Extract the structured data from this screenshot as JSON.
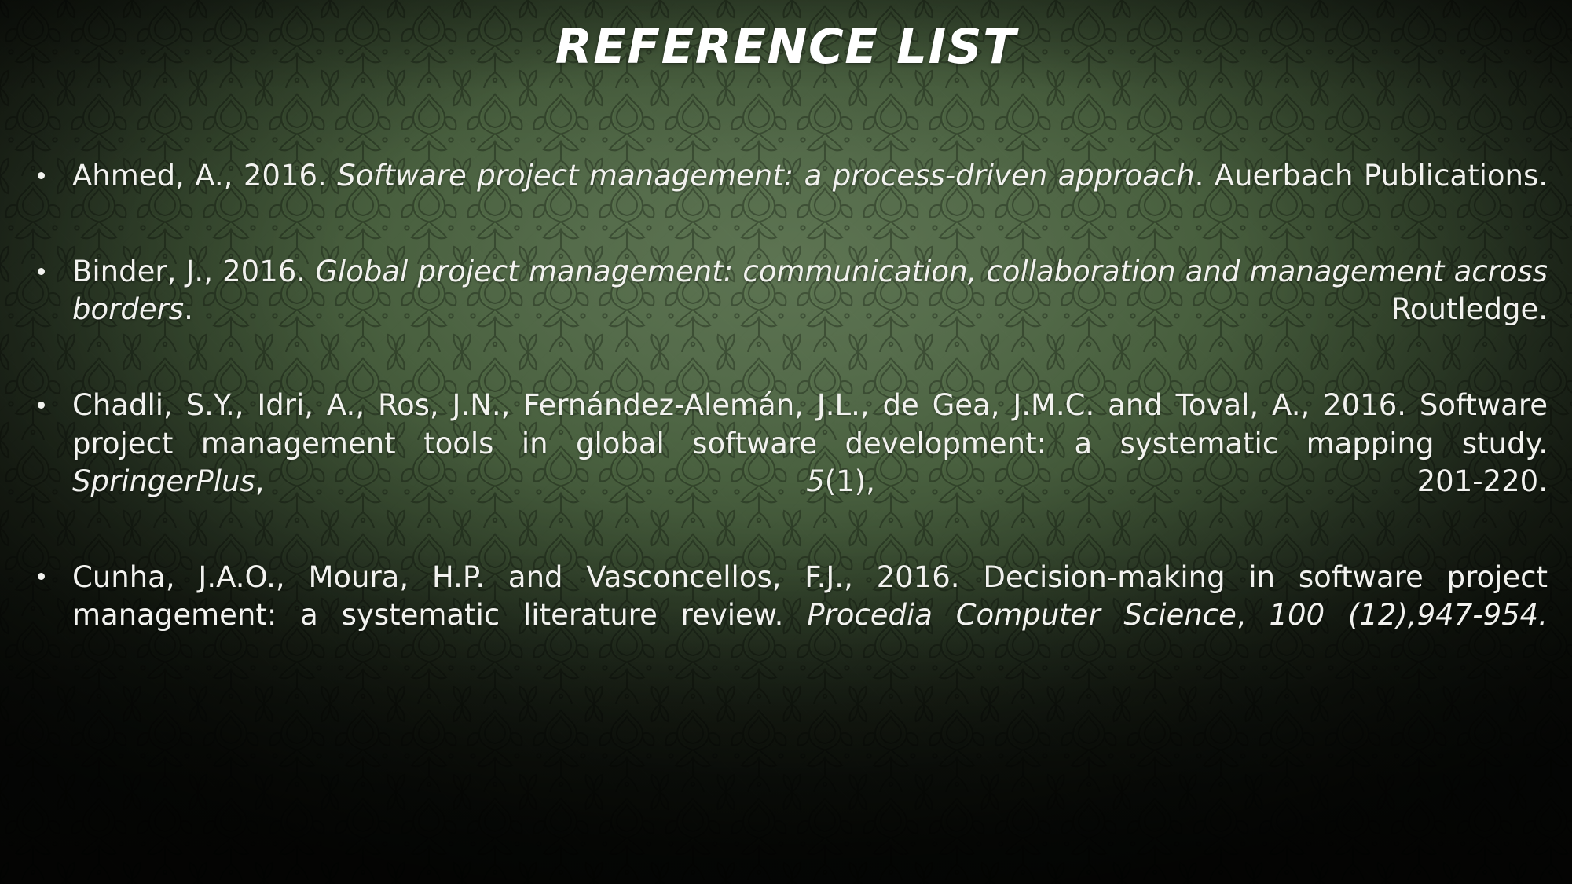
{
  "slide": {
    "title": "REFERENCE LIST",
    "background_color": "#3d4f35",
    "background_center_color": "#5d7452",
    "background_edge_color": "#1c2418",
    "text_color": "#f2f2ef",
    "bullet_glyph": "•"
  },
  "references": [
    {
      "id": "ref-ahmed",
      "runs": [
        {
          "text": "Ahmed, A., 2016. ",
          "italic": false
        },
        {
          "text": "Software project management: a process-driven approach",
          "italic": true
        },
        {
          "text": ". Auerbach Publications.",
          "italic": false
        }
      ],
      "plain": "Ahmed, A., 2016. Software project management: a process-driven approach. Auerbach Publications."
    },
    {
      "id": "ref-binder",
      "runs": [
        {
          "text": "Binder, J., 2016. ",
          "italic": false
        },
        {
          "text": "Global project management: communication, collaboration and management across borders",
          "italic": true
        },
        {
          "text": ". Routledge.",
          "italic": false
        }
      ],
      "plain": "Binder, J., 2016. Global project management: communication, collaboration and management across borders. Routledge."
    },
    {
      "id": "ref-chadli",
      "runs": [
        {
          "text": "Chadli, S.Y., Idri, A., Ros, J.N., Fernández-Alemán, J.L., de Gea, J.M.C. and Toval, A., 2016. Software project management tools in global software development: a systematic mapping study. ",
          "italic": false
        },
        {
          "text": "SpringerPlus",
          "italic": true
        },
        {
          "text": ", ",
          "italic": false
        },
        {
          "text": "5",
          "italic": true
        },
        {
          "text": "(1), 201-220.",
          "italic": false
        }
      ],
      "plain": "Chadli, S.Y., Idri, A., Ros, J.N., Fernández-Alemán, J.L., de Gea, J.M.C. and Toval, A., 2016. Software project management tools in global software development: a systematic mapping study. SpringerPlus, 5(1), 201-220."
    },
    {
      "id": "ref-cunha",
      "runs": [
        {
          "text": "Cunha, J.A.O., Moura, H.P. and Vasconcellos, F.J., 2016. Decision-making in software project management: a systematic literature review. ",
          "italic": false
        },
        {
          "text": "Procedia Computer Science",
          "italic": true
        },
        {
          "text": ", ",
          "italic": false
        },
        {
          "text": "100 (12),947-954.",
          "italic": true
        }
      ],
      "plain": "Cunha, J.A.O., Moura, H.P. and Vasconcellos, F.J., 2016. Decision-making in software project management: a systematic literature review. Procedia Computer Science, 100 (12),947-954."
    }
  ]
}
